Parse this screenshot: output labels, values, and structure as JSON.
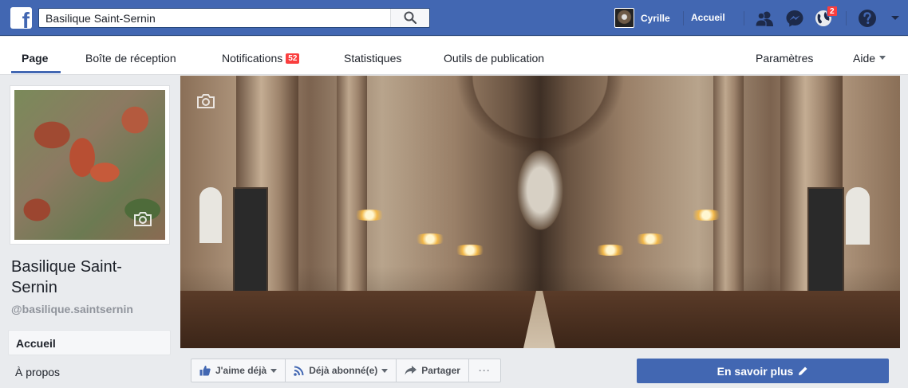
{
  "topbar": {
    "logo": "f",
    "search_value": "Basilique Saint-Sernin",
    "user_name": "Cyrille",
    "home_label": "Accueil",
    "notification_count": "2",
    "icons": [
      "friends-icon",
      "messenger-icon",
      "globe-notifications-icon",
      "help-icon",
      "dropdown-caret-icon"
    ]
  },
  "tabs": [
    {
      "label": "Page"
    },
    {
      "label": "Boîte de réception"
    },
    {
      "label": "Notifications",
      "badge": "52"
    },
    {
      "label": "Statistiques"
    },
    {
      "label": "Outils de publication"
    },
    {
      "label": "Paramètres"
    },
    {
      "label": "Aide"
    }
  ],
  "page": {
    "name": "Basilique Saint-Sernin",
    "name_line1": "Basilique Saint-",
    "name_line2": "Sernin",
    "handle": "@basilique.saintsernin"
  },
  "sidebar": {
    "items": [
      {
        "label": "Accueil"
      },
      {
        "label": "À propos"
      }
    ]
  },
  "actions": {
    "like": "J'aime déjà",
    "follow": "Déjà abonné(e)",
    "share": "Partager",
    "more": "···",
    "learn_more": "En savoir plus"
  },
  "colors": {
    "brand_blue": "#4267b2",
    "badge_red": "#fa3e3e",
    "page_bg": "#e9ebee"
  }
}
